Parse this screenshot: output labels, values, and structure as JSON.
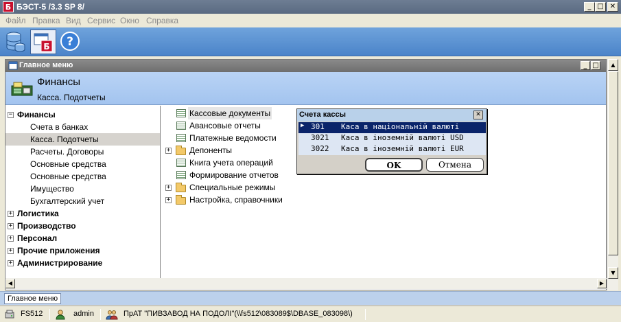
{
  "window": {
    "title": "БЭСТ-5 /3.3 SP 8/",
    "app_icon_letter": "Б",
    "minimize": "_",
    "maximize": "□",
    "close": "✕"
  },
  "menu": {
    "items": [
      "Файл",
      "Правка",
      "Вид",
      "Сервис",
      "Окно",
      "Справка"
    ]
  },
  "toolbar": {
    "icons": [
      "database-icon",
      "best-app-icon",
      "help-icon"
    ],
    "help_glyph": "?"
  },
  "inner_window": {
    "title": "Главное меню",
    "header_title": "Финансы",
    "header_subtitle": "Касса. Подотчеты"
  },
  "tree": {
    "items": [
      {
        "label": "Финансы",
        "bold": true,
        "expander": "−"
      },
      {
        "label": "Счета в банках",
        "bold": false
      },
      {
        "label": "Касса. Подотчеты",
        "bold": false,
        "selected": true
      },
      {
        "label": "Расчеты. Договоры",
        "bold": false
      },
      {
        "label": "Основные средства",
        "bold": false
      },
      {
        "label": "Основные средства",
        "bold": false
      },
      {
        "label": "Имущество",
        "bold": false
      },
      {
        "label": "Бухгалтерский учет",
        "bold": false
      },
      {
        "label": "Логистика",
        "bold": true,
        "expander": "+"
      },
      {
        "label": "Производство",
        "bold": true,
        "expander": "+"
      },
      {
        "label": "Персонал",
        "bold": true,
        "expander": "+"
      },
      {
        "label": "Прочие приложения",
        "bold": true,
        "expander": "+"
      },
      {
        "label": "Администрирование",
        "bold": true,
        "expander": "+"
      }
    ]
  },
  "right_list": {
    "items": [
      {
        "label": "Кассовые документы",
        "kind": "doc"
      },
      {
        "label": "Авансовые отчеты",
        "kind": "doc"
      },
      {
        "label": "Платежные ведомости",
        "kind": "doc"
      },
      {
        "label": "Депоненты",
        "kind": "folder",
        "expander": "+"
      },
      {
        "label": "Книга учета операций",
        "kind": "doc"
      },
      {
        "label": "Формирование отчетов",
        "kind": "doc"
      },
      {
        "label": "Специальные режимы",
        "kind": "folder",
        "expander": "+"
      },
      {
        "label": "Настройка, справочники",
        "kind": "folder",
        "expander": "+"
      }
    ]
  },
  "dialog": {
    "title": "Счета кассы",
    "close": "✕",
    "rows": [
      {
        "code": "301",
        "name": "Каса в національній валюті",
        "selected": true
      },
      {
        "code": "3021",
        "name": "Каса в іноземній валюті USD"
      },
      {
        "code": "3022",
        "name": "Каса в іноземній валюті EUR"
      }
    ],
    "ok_label": "OK",
    "cancel_label": "Отмена",
    "row_pointer": "▶"
  },
  "tabs": {
    "active": "Главное меню"
  },
  "status": {
    "server": "FS512",
    "user": "admin",
    "company": "ПрАТ \"ПИВЗАВОД НА ПОДОЛІ\"(\\\\fs512\\083089$\\DBASE_083098\\)"
  },
  "colors": {
    "selection": "#0a246a",
    "header_bg": "#b9d3f5",
    "toolbar_bg": "#5b91d3"
  }
}
